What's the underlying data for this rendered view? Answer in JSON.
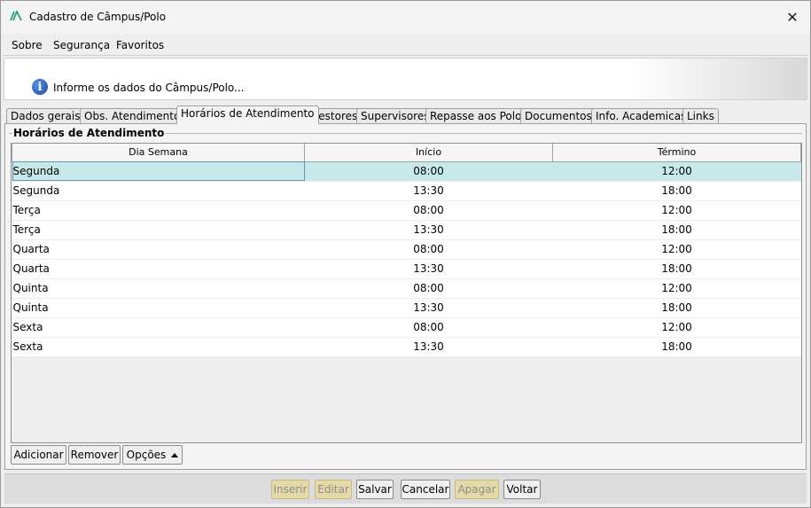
{
  "window": {
    "title": "Cadastro de Câmpus/Polo",
    "close_glyph": "✕"
  },
  "menu": {
    "items": [
      "Sobre",
      "Segurança",
      "Favoritos"
    ]
  },
  "header": {
    "info_text": "Informe os dados do Câmpus/Polo..."
  },
  "tabs": [
    "Dados gerais",
    "Obs. Atendimento",
    "Horários de Atendimento",
    "Gestores",
    "Supervisores",
    "Repasse aos Polos",
    "Documentos",
    "Info. Academicas",
    "Links"
  ],
  "active_tab": "Horários de Atendimento",
  "group": {
    "title": "Horários de Atendimento"
  },
  "table": {
    "columns": [
      "Dia Semana",
      "Início",
      "Término"
    ],
    "rows": [
      [
        "Segunda",
        "08:00",
        "12:00"
      ],
      [
        "Segunda",
        "13:30",
        "18:00"
      ],
      [
        "Terça",
        "08:00",
        "12:00"
      ],
      [
        "Terça",
        "13:30",
        "18:00"
      ],
      [
        "Quarta",
        "08:00",
        "12:00"
      ],
      [
        "Quarta",
        "13:30",
        "18:00"
      ],
      [
        "Quinta",
        "08:00",
        "12:00"
      ],
      [
        "Quinta",
        "13:30",
        "18:00"
      ],
      [
        "Sexta",
        "08:00",
        "12:00"
      ],
      [
        "Sexta",
        "13:30",
        "18:00"
      ]
    ]
  },
  "table_buttons": {
    "add": "Adicionar",
    "remove": "Remover",
    "options": "Opções"
  },
  "footer_buttons": {
    "insert": "Inserir",
    "edit": "Editar",
    "save": "Salvar",
    "cancel": "Cancelar",
    "delete": "Apagar",
    "back": "Voltar"
  },
  "colors": {
    "selected_row": "#c8e9e9",
    "disabled_button": "#e6d9a8",
    "logo": "#2e9d6e"
  },
  "icons": {
    "logo": "app-logo-icon",
    "info": "info-icon",
    "close": "close-icon",
    "options_caret": "caret-up-icon"
  }
}
